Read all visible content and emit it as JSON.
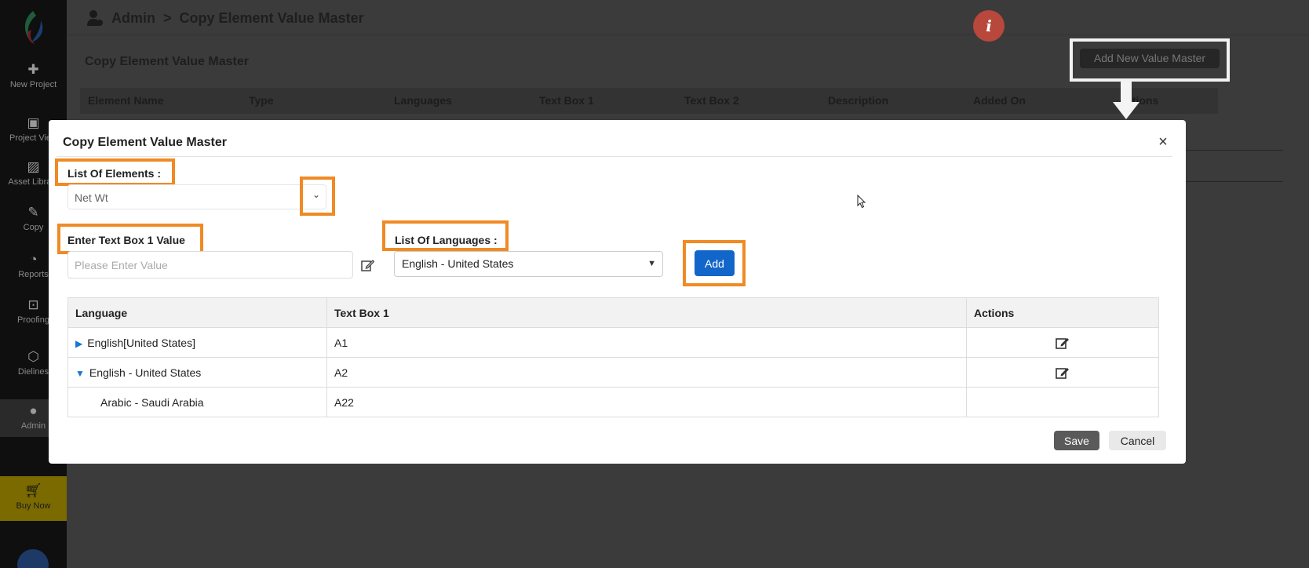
{
  "sidebar": {
    "items": [
      {
        "label": "New Project",
        "icon": "plus-icon"
      },
      {
        "label": "Project View",
        "icon": "project-view-icon"
      },
      {
        "label": "Asset Library",
        "icon": "image-icon"
      },
      {
        "label": "Copy",
        "icon": "edit-icon"
      },
      {
        "label": "Reports",
        "icon": "pie-chart-icon"
      },
      {
        "label": "Proofing",
        "icon": "proofing-icon"
      },
      {
        "label": "Dielines",
        "icon": "cube-icon"
      },
      {
        "label": "Admin",
        "icon": "admin-icon"
      }
    ],
    "buy_now": "Buy Now"
  },
  "header": {
    "breadcrumb_root": "Admin",
    "breadcrumb_sep": ">",
    "breadcrumb_page": "Copy Element Value Master",
    "info_glyph": "i"
  },
  "page": {
    "title": "Copy Element Value Master",
    "add_button": "Add New Value Master",
    "columns": [
      "Element Name",
      "Type",
      "Languages",
      "Text Box 1",
      "Text Box 2",
      "Description",
      "Added On",
      "Actions"
    ]
  },
  "modal": {
    "title": "Copy Element Value Master",
    "close": "×",
    "elements_label": "List Of Elements :",
    "elements_value": "Net Wt",
    "textbox_label": "Enter Text Box 1 Value",
    "textbox_placeholder": "Please Enter Value",
    "languages_label": "List Of Languages :",
    "languages_value": "English - United States",
    "add_button": "Add",
    "table": {
      "headers": [
        "Language",
        "Text Box 1",
        "Actions"
      ],
      "rows": [
        {
          "language": "English[United States]",
          "value": "A1",
          "expander": "▶"
        },
        {
          "language": "English - United States",
          "value": "A2",
          "expander": "▼"
        },
        {
          "language": "Arabic - Saudi Arabia",
          "value": "A22",
          "expander": ""
        }
      ]
    },
    "save_button": "Save",
    "cancel_button": "Cancel"
  },
  "colors": {
    "highlight": "#f08a24",
    "primary": "#1366c9",
    "info_badge": "#b8473c"
  }
}
